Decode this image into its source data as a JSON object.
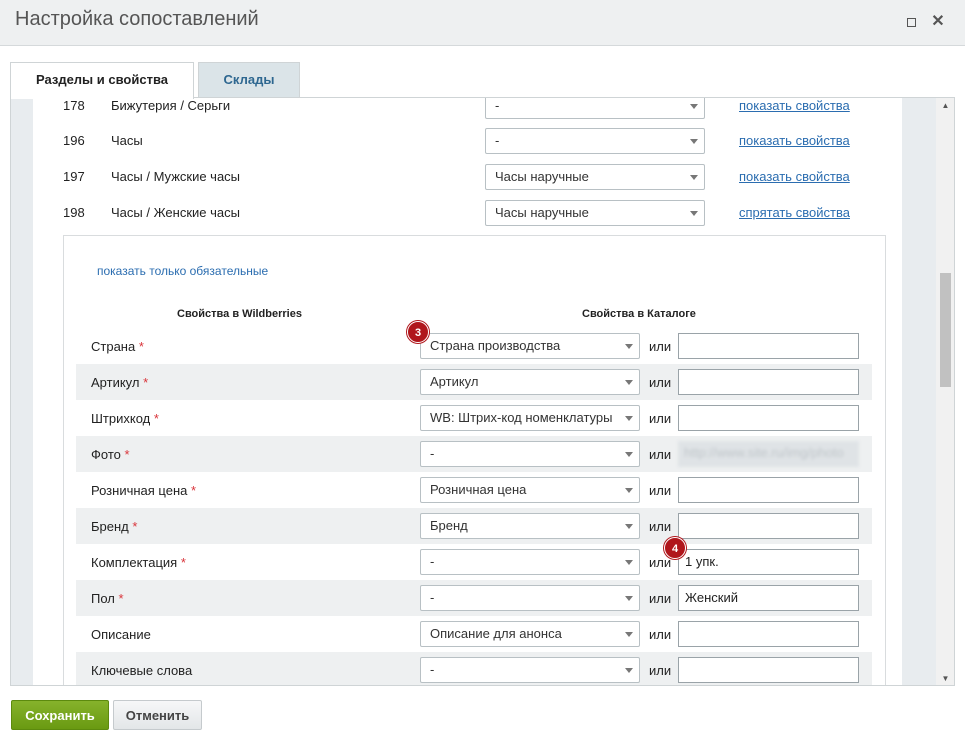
{
  "window": {
    "title": "Настройка сопоставлений",
    "maximize_icon": "maximize-icon",
    "close_icon": "close-icon"
  },
  "tabs": [
    {
      "label": "Разделы и свойства",
      "active": true
    },
    {
      "label": "Склады",
      "active": false
    }
  ],
  "categories": [
    {
      "id": "178",
      "name": "Бижутерия / Серьги",
      "selected": "-",
      "link": "показать свойства"
    },
    {
      "id": "196",
      "name": "Часы",
      "selected": "-",
      "link": "показать свойства"
    },
    {
      "id": "197",
      "name": "Часы / Мужские часы",
      "selected": "Часы наручные",
      "link": "показать свойства"
    },
    {
      "id": "198",
      "name": "Часы / Женские часы",
      "selected": "Часы наручные",
      "link": "спрятать свойства"
    }
  ],
  "properties_panel": {
    "required_link": "показать только обязательные",
    "col_wb": "Свойства в Wildberries",
    "col_catalog": "Свойства в Каталоге",
    "or_label": "или",
    "required_marker": "*",
    "rows": [
      {
        "name": "Страна",
        "required": true,
        "selected": "Страна производства",
        "value": ""
      },
      {
        "name": "Артикул",
        "required": true,
        "selected": "Артикул",
        "value": ""
      },
      {
        "name": "Штрихкод",
        "required": true,
        "selected": "WB: Штрих-код номенклатуры",
        "value": ""
      },
      {
        "name": "Фото",
        "required": true,
        "selected": "-",
        "value": "http://www.site.ru/img/photo"
      },
      {
        "name": "Розничная цена",
        "required": true,
        "selected": "Розничная цена",
        "value": ""
      },
      {
        "name": "Бренд",
        "required": true,
        "selected": "Бренд",
        "value": ""
      },
      {
        "name": "Комплектация",
        "required": true,
        "selected": "-",
        "value": "1 упк."
      },
      {
        "name": "Пол",
        "required": true,
        "selected": "-",
        "value": "Женский"
      },
      {
        "name": "Описание",
        "required": false,
        "selected": "Описание для анонса",
        "value": ""
      },
      {
        "name": "Ключевые слова",
        "required": false,
        "selected": "-",
        "value": ""
      }
    ]
  },
  "badges": {
    "first": "3",
    "second": "4"
  },
  "footer": {
    "save_label": "Сохранить",
    "cancel_label": "Отменить"
  },
  "colors": {
    "save_button": "#74a31a",
    "link": "#2b6db0",
    "badge": "#b0161c",
    "required": "#d9343a"
  }
}
